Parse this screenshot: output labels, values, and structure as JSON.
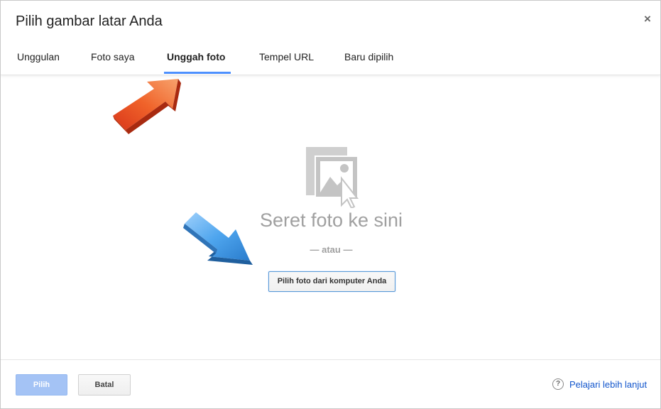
{
  "dialog": {
    "title": "Pilih gambar latar Anda",
    "close_label": "×"
  },
  "tabs": [
    {
      "label": "Unggulan",
      "active": false
    },
    {
      "label": "Foto saya",
      "active": false
    },
    {
      "label": "Unggah foto",
      "active": true
    },
    {
      "label": "Tempel URL",
      "active": false
    },
    {
      "label": "Baru dipilih",
      "active": false
    }
  ],
  "upload": {
    "drop_text": "Seret foto ke sini",
    "or_text": "— atau —",
    "choose_button": "Pilih foto dari komputer Anda"
  },
  "footer": {
    "select_button": "Pilih",
    "cancel_button": "Batal",
    "help_link": "Pelajari lebih lanjut",
    "help_icon_glyph": "?"
  },
  "annotations": {
    "arrow_tab_color": "#e8571e",
    "arrow_button_color": "#3a8fd8"
  },
  "colors": {
    "accent": "#4d90fe",
    "link": "#1155cc",
    "disabled_primary": "#a4c3f5"
  }
}
